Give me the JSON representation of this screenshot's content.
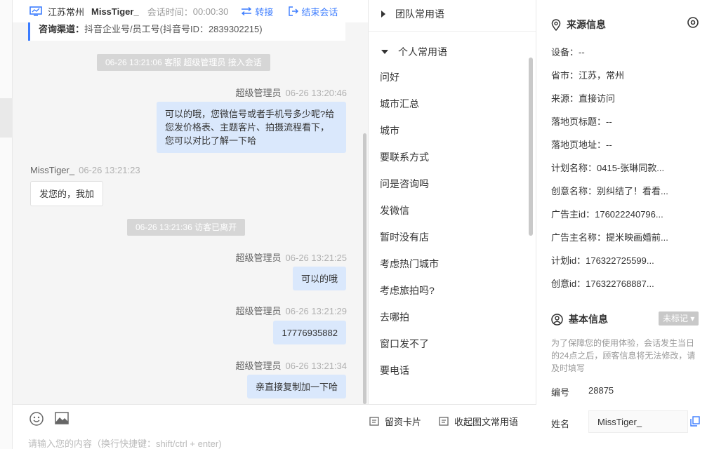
{
  "header": {
    "location": "江苏常州",
    "username": "MissTiger_",
    "session_time_label": "会话时间：",
    "session_time": "00:00:30",
    "transfer_label": "转接",
    "end_label": "结束会话"
  },
  "channel": {
    "label": "咨询渠道：",
    "value": "抖音企业号/员工号(抖音号ID：2839302215)"
  },
  "messages": {
    "sys1": "06-26 13:21:06 客服 超级管理员 接入会话",
    "m1_sender": "超级管理员",
    "m1_time": "06-26 13:20:46",
    "m1_text": "可以的哦，您微信号或者手机号多少呢?给您发价格表、主题客片、拍摄流程看下，您可以对比了解一下哈",
    "m2_sender": "MissTiger_",
    "m2_time": "06-26 13:21:23",
    "m2_text": "发您的，我加",
    "sys2": "06-26 13:21:36 访客已离开",
    "m3_sender": "超级管理员",
    "m3_time": "06-26 13:21:25",
    "m3_text": "可以的哦",
    "m4_sender": "超级管理员",
    "m4_time": "06-26 13:21:29",
    "m4_text": "17776935882",
    "m5_sender": "超级管理员",
    "m5_time": "06-26 13:21:34",
    "m5_text": "亲直接复制加一下哈"
  },
  "phrases": {
    "team_group": "团队常用语",
    "personal_group": "个人常用语",
    "items": [
      "问好",
      "城市汇总",
      "城市",
      "要联系方式",
      "问是咨询吗",
      "发微信",
      "暂时没有店",
      "考虑热门城市",
      "考虑旅拍吗?",
      "去哪拍",
      "窗口发不了",
      "要电话"
    ]
  },
  "input": {
    "card_label": "留资卡片",
    "collapse_label": "收起图文常用语",
    "placeholder": "请输入您的内容（换行快捷键：shift/ctrl + enter)"
  },
  "source_info": {
    "title": "来源信息",
    "rows": [
      "设备：--",
      "省市：江苏，常州",
      "来源：直接访问",
      "落地页标题：--",
      "落地页地址：--",
      "计划名称：0415-张琳同款...",
      "创意名称：别纠结了！看看...",
      "广告主id：176022240796...",
      "广告主名称：提米映画婚前...",
      "计划id：176322725599...",
      "创意id：176322768887..."
    ]
  },
  "basic_info": {
    "title": "基本信息",
    "badge": "未标记",
    "notice": "为了保障您的使用体验，会话发生当日的24点之后，顾客信息将无法修改，请及时填写",
    "id_label": "编号",
    "id_value": "28875",
    "name_label": "姓名",
    "name_value": "MissTiger_"
  },
  "colors": {
    "accent": "#3b7cff",
    "bubble_me": "#dae8fc",
    "system_tag": "#d6d6d6"
  }
}
